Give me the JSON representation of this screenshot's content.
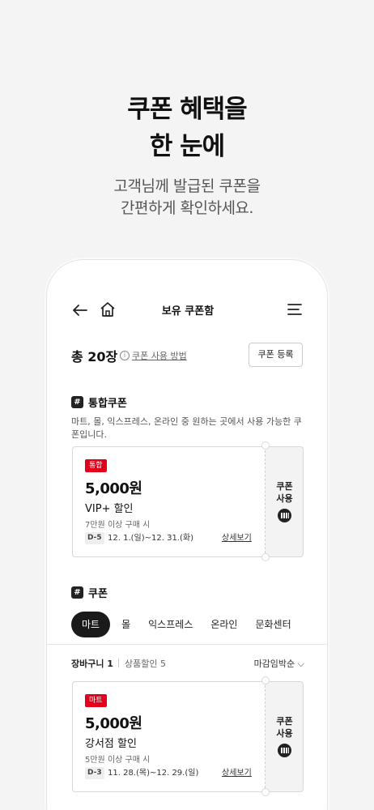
{
  "hero": {
    "title_line1": "쿠폰 혜택을",
    "title_line2": "한 눈에",
    "sub_line1": "고객님께 발급된 쿠폰을",
    "sub_line2": "간편하게 확인하세요."
  },
  "topbar": {
    "title": "보유 쿠폰함"
  },
  "summary": {
    "total": "총 20장",
    "howto": "쿠폰 사용 방법",
    "register": "쿠폰 등록"
  },
  "integrated": {
    "heading": "통합쿠폰",
    "desc": "마트, 몰, 익스프레스, 온라인 중 원하는 곳에서 사용 가능한 쿠폰입니다.",
    "coupon": {
      "badge": "통합",
      "amount": "5,000원",
      "name": "VIP+ 할인",
      "condition": "7만원 이상 구매 시",
      "dday": "D-5",
      "period": "12. 1.(일)~12. 31.(화)",
      "detail": "상세보기",
      "use_line1": "쿠폰",
      "use_line2": "사용"
    }
  },
  "coupons": {
    "heading": "쿠폰",
    "tabs": [
      "마트",
      "몰",
      "익스프레스",
      "온라인",
      "문화센터"
    ],
    "filter": {
      "cart": "장바구니 1",
      "discount": "상품할인 5",
      "sort": "마감임박순 ⌵"
    },
    "coupon": {
      "badge": "마트",
      "amount": "5,000원",
      "name": "강서점 할인",
      "condition": "5만원 이상 구매 시",
      "dday": "D-3",
      "period": "11. 28.(목)~12. 29.(일)",
      "detail": "상세보기",
      "use_line1": "쿠폰",
      "use_line2": "사용"
    }
  },
  "colors": {
    "accent": "#e2001a",
    "dark": "#1a1a1a"
  }
}
